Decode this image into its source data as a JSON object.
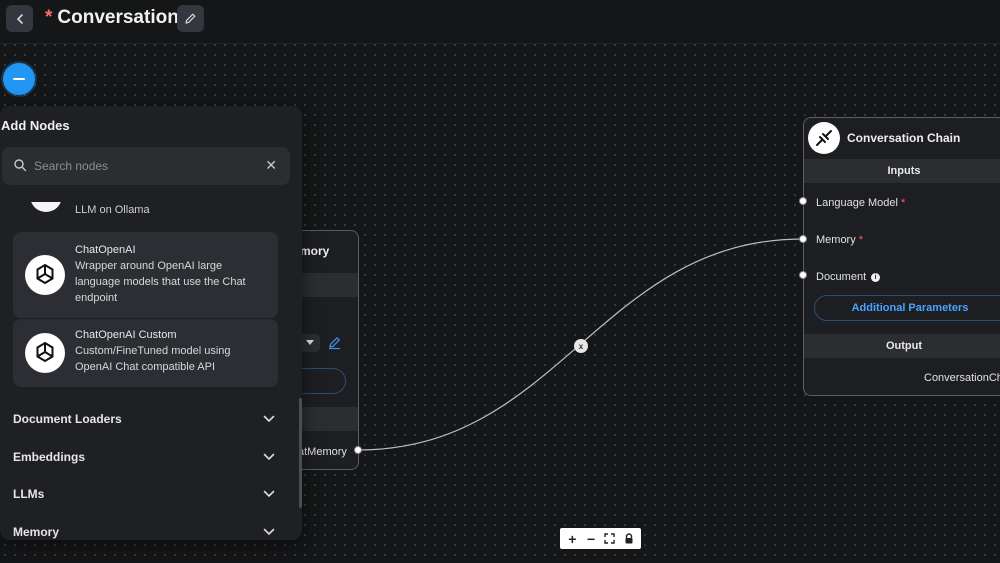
{
  "header": {
    "unsaved_marker": "*",
    "title": "Conversation"
  },
  "add_nodes": {
    "title": "Add Nodes",
    "search_placeholder": "Search nodes",
    "partial_item_label": "LLM on Ollama",
    "items": [
      {
        "name": "ChatOpenAI",
        "description": "Wrapper around OpenAI large language models that use the Chat endpoint"
      },
      {
        "name": "ChatOpenAI Custom",
        "description": "Custom/FineTuned model using OpenAI Chat compatible API"
      }
    ],
    "categories": [
      {
        "label": "Document Loaders"
      },
      {
        "label": "Embeddings"
      },
      {
        "label": "LLMs"
      },
      {
        "label": "Memory"
      }
    ]
  },
  "memory_node": {
    "title_partial": "mory",
    "output_partial": "atMemory"
  },
  "conversation_chain": {
    "title": "Conversation Chain",
    "inputs_label": "Inputs",
    "fields": [
      {
        "label": "Language Model",
        "required": "*"
      },
      {
        "label": "Memory",
        "required": "*"
      },
      {
        "label": "Document",
        "info": "i"
      }
    ],
    "additional_params_label": "Additional Parameters",
    "output_label": "Output",
    "output_value": "ConversationCha"
  },
  "edge": {
    "delete_label": "x"
  },
  "canvas_controls": {
    "zoom_in": "+",
    "zoom_out": "−",
    "fit_view": "⛶",
    "lock": "🔒"
  },
  "colors": {
    "accent": "#2196f3",
    "link": "#4aa3ff",
    "required": "#ff5c5c",
    "background": "#151617"
  }
}
